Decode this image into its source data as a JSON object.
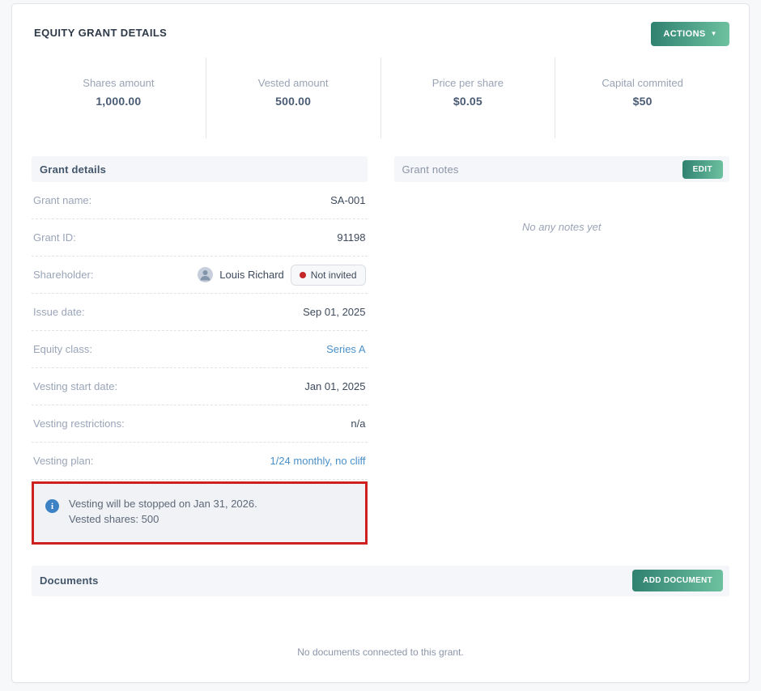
{
  "page": {
    "title": "EQUITY GRANT DETAILS"
  },
  "actions_button": {
    "label": "ACTIONS",
    "caret": "▼"
  },
  "stats": [
    {
      "label": "Shares amount",
      "value": "1,000.00"
    },
    {
      "label": "Vested amount",
      "value": "500.00"
    },
    {
      "label": "Price per share",
      "value": "$0.05"
    },
    {
      "label": "Capital commited",
      "value": "$50"
    }
  ],
  "grant_details": {
    "header": "Grant details",
    "rows": [
      {
        "label": "Grant name:",
        "value": "SA-001"
      },
      {
        "label": "Grant ID:",
        "value": "91198"
      },
      {
        "label": "Shareholder:",
        "value": "Louis Richard",
        "badge": "Not invited"
      },
      {
        "label": "Issue date:",
        "value": "Sep 01, 2025"
      },
      {
        "label": "Equity class:",
        "value": "Series A"
      },
      {
        "label": "Vesting start date:",
        "value": "Jan 01, 2025"
      },
      {
        "label": "Vesting restrictions:",
        "value": "n/a"
      },
      {
        "label": "Vesting plan:",
        "value": "1/24 monthly, no cliff"
      }
    ],
    "info_note": {
      "line1": "Vesting will be stopped on Jan 31, 2026.",
      "line2": "Vested shares: 500"
    }
  },
  "grant_notes": {
    "header": "Grant notes",
    "edit_label": "EDIT",
    "empty_text": "No any notes yet"
  },
  "documents": {
    "header": "Documents",
    "add_label": "ADD DOCUMENT",
    "empty_text": "No documents connected to this grant."
  },
  "colors": {
    "accent_teal_dark": "#2f8170",
    "accent_teal_light": "#6ec2a0",
    "link_blue": "#4a90c9",
    "annotation_red": "#cf2020",
    "status_dot_red": "#c32727",
    "info_icon_blue": "#3d82c4"
  }
}
